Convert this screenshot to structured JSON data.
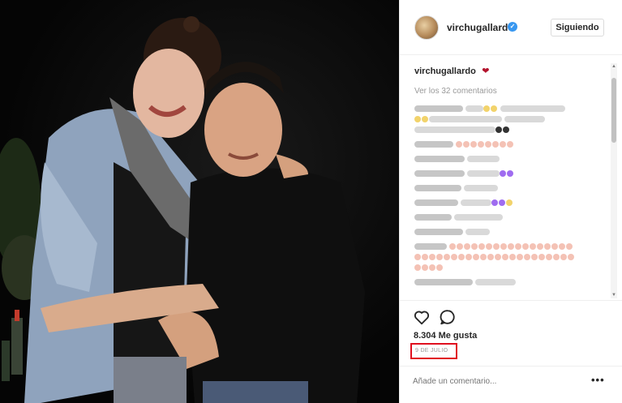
{
  "post": {
    "username": "virchugallardo",
    "follow_label": "Siguiendo",
    "caption_user": "virchugallardo",
    "caption_emoji": "❤",
    "view_comments": "Ver los 32 comentarios",
    "likes": "8.304 Me gusta",
    "date": "9 DE JULIO",
    "add_comment_placeholder": "Añade un comentario...",
    "more_label": "•••",
    "verified_icon": "✓"
  },
  "icons": {
    "like": "heart-outline-icon",
    "comment": "speech-bubble-icon",
    "verified": "verified-badge-icon",
    "more": "ellipsis-icon"
  },
  "colors": {
    "accent": "#3897f0",
    "heart": "#b3132d",
    "highlight": "#e0101f"
  }
}
